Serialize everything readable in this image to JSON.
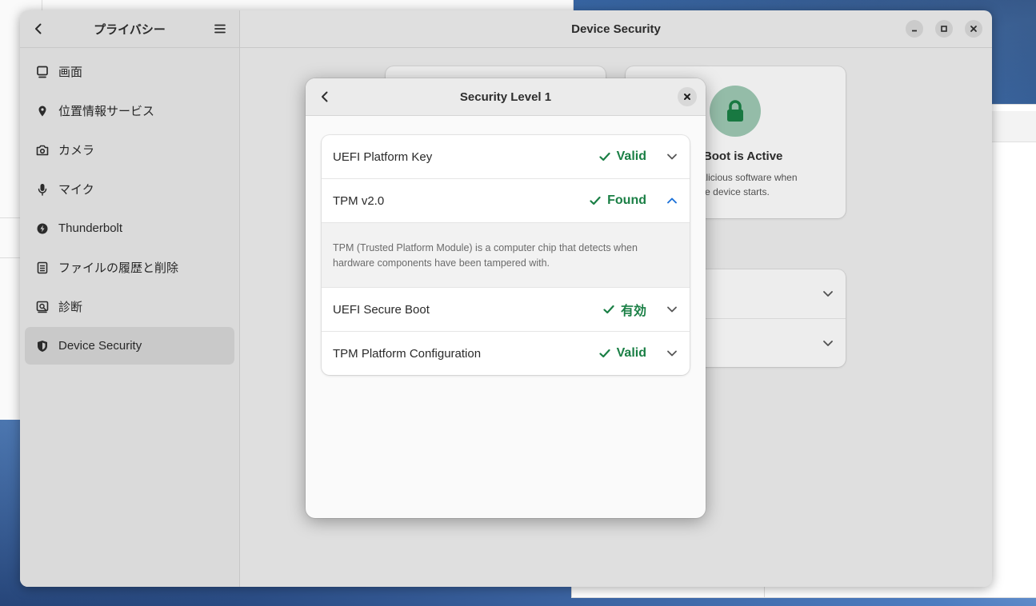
{
  "sidebar": {
    "title": "プライバシー",
    "items": [
      {
        "label": "画面",
        "icon": "monitor-icon"
      },
      {
        "label": "位置情報サービス",
        "icon": "location-pin-icon"
      },
      {
        "label": "カメラ",
        "icon": "camera-icon"
      },
      {
        "label": "マイク",
        "icon": "microphone-icon"
      },
      {
        "label": "Thunderbolt",
        "icon": "thunderbolt-icon"
      },
      {
        "label": "ファイルの履歴と削除",
        "icon": "file-history-icon"
      },
      {
        "label": "診断",
        "icon": "diagnostics-icon"
      },
      {
        "label": "Device Security",
        "icon": "shield-icon",
        "active": true
      }
    ]
  },
  "content": {
    "title": "Device Security",
    "secure_boot_card": {
      "title": "re Boot is Active",
      "desc_line1": "nst malicious software when",
      "desc_line2": "e device starts."
    }
  },
  "dialog": {
    "title": "Security Level 1",
    "rows": [
      {
        "label": "UEFI Platform Key",
        "status": "Valid",
        "expanded": false
      },
      {
        "label": "TPM v2.0",
        "status": "Found",
        "expanded": true,
        "detail": "TPM (Trusted Platform Module) is a computer chip that detects when hardware components have been tampered with."
      },
      {
        "label": "UEFI Secure Boot",
        "status": "有効",
        "expanded": false
      },
      {
        "label": "TPM Platform Configuration",
        "status": "Valid",
        "expanded": false
      }
    ]
  },
  "colors": {
    "status_ok": "#1a7f45",
    "accent_blue": "#1c71d8",
    "lock_green": "#1a7f45"
  }
}
